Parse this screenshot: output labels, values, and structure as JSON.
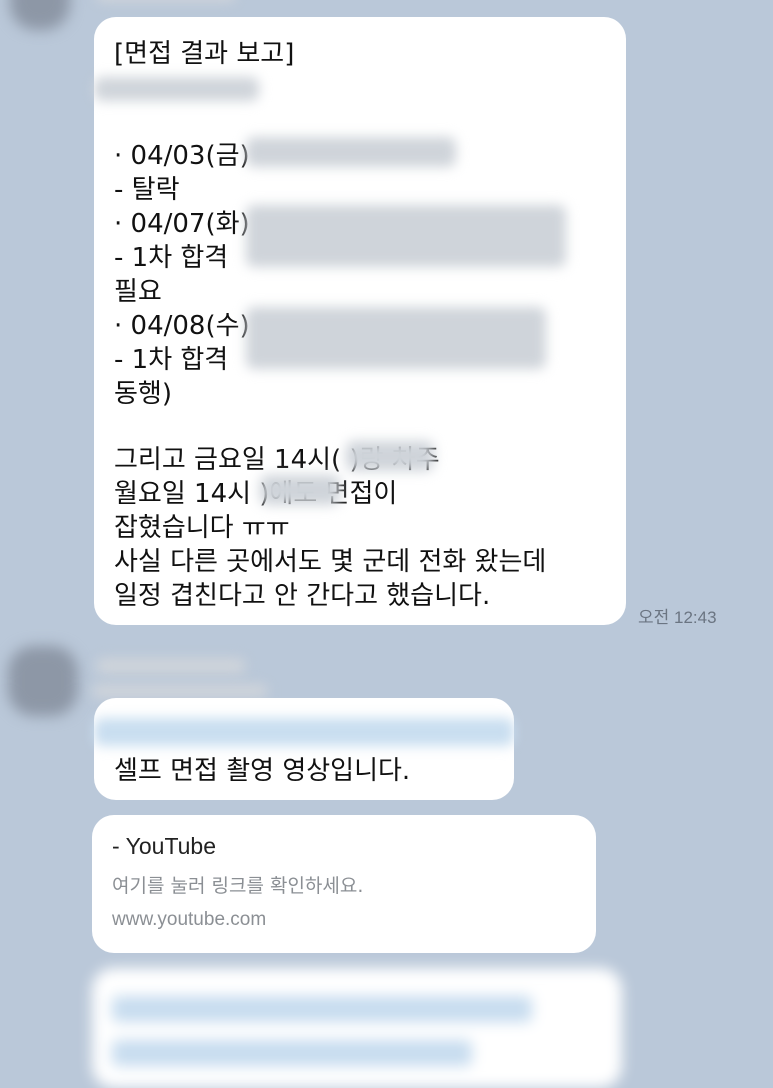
{
  "messages": [
    {
      "lines": [
        "[면접 결과 보고]",
        "",
        "",
        "· 04/03(금)",
        "  - 탈락",
        "· 04/07(화)",
        "  - 1차 합격",
        "필요",
        "· 04/08(수)",
        "  - 1차 합격",
        "동행)",
        "",
        "그리고 금요일 14시(          )랑 차주",
        "월요일 14시           )에도 면접이",
        "잡혔습니다 ㅠㅠ",
        "사실 다른 곳에서도 몇 군데 전화 왔는데",
        "일정 겹친다고 안 간다고 했습니다."
      ],
      "time": "오전 12:43"
    },
    {
      "text": "셀프 면접 촬영 영상입니다."
    }
  ],
  "link_preview": {
    "title": "- YouTube",
    "description": "여기를 눌러 링크를 확인하세요.",
    "url": "www.youtube.com"
  }
}
